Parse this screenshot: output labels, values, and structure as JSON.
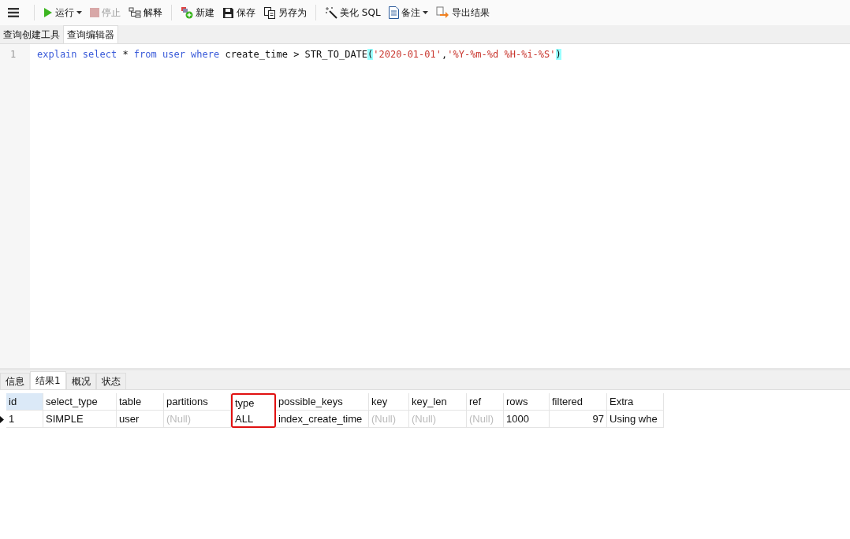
{
  "toolbar": [
    {
      "kind": "play",
      "label": "运行",
      "disabled": false,
      "dropdown": true
    },
    {
      "kind": "stop",
      "label": "停止",
      "disabled": true,
      "dropdown": false
    },
    {
      "kind": "explain",
      "label": "解释",
      "disabled": false,
      "dropdown": false
    },
    {
      "kind": "new",
      "label": "新建",
      "disabled": false,
      "dropdown": false
    },
    {
      "kind": "save",
      "label": "保存",
      "disabled": false,
      "dropdown": false
    },
    {
      "kind": "saveas",
      "label": "另存为",
      "disabled": false,
      "dropdown": false
    },
    {
      "kind": "wand",
      "label": "美化 SQL",
      "disabled": false,
      "dropdown": false
    },
    {
      "kind": "note",
      "label": "备注",
      "disabled": false,
      "dropdown": true
    },
    {
      "kind": "export",
      "label": "导出结果",
      "disabled": false,
      "dropdown": false
    }
  ],
  "editor_tabs": [
    {
      "label": "查询创建工具",
      "selected": false
    },
    {
      "label": "查询编辑器",
      "selected": true
    }
  ],
  "editor": {
    "lines": [
      {
        "number": "1",
        "tokens": [
          {
            "kind": "keyword",
            "text": "explain"
          },
          {
            "kind": "keyword",
            "text": "select"
          },
          {
            "kind": "plain",
            "text": "*"
          },
          {
            "kind": "keyword",
            "text": "from"
          },
          {
            "kind": "keyword",
            "text": "user"
          },
          {
            "kind": "keyword",
            "text": "where"
          },
          {
            "kind": "plain",
            "text": "create_time"
          },
          {
            "kind": "plain",
            "text": ">"
          },
          {
            "kind": "plain",
            "text": "STR_TO_DATE"
          },
          {
            "kind": "bracket",
            "text": "("
          },
          {
            "kind": "string",
            "text": "'2020-01-01'"
          },
          {
            "kind": "plain",
            "text": ","
          },
          {
            "kind": "string",
            "text": "'%Y-%m-%d %H-%i-%S'"
          },
          {
            "kind": "bracket",
            "text": ")"
          }
        ]
      }
    ]
  },
  "result_tabs": [
    {
      "label": "信息",
      "selected": false
    },
    {
      "label": "结果1",
      "selected": true
    },
    {
      "label": "概况",
      "selected": false
    },
    {
      "label": "状态",
      "selected": false
    }
  ],
  "table": {
    "columns": [
      {
        "label": "id",
        "selected": true,
        "highlighted": false
      },
      {
        "label": "select_type",
        "selected": false,
        "highlighted": false
      },
      {
        "label": "table",
        "selected": false,
        "highlighted": false
      },
      {
        "label": "partitions",
        "selected": false,
        "highlighted": false
      },
      {
        "label": "type",
        "selected": false,
        "highlighted": true
      },
      {
        "label": "possible_keys",
        "selected": false,
        "highlighted": false
      },
      {
        "label": "key",
        "selected": false,
        "highlighted": false
      },
      {
        "label": "key_len",
        "selected": false,
        "highlighted": false
      },
      {
        "label": "ref",
        "selected": false,
        "highlighted": false
      },
      {
        "label": "rows",
        "selected": false,
        "highlighted": false
      },
      {
        "label": "filtered",
        "selected": false,
        "highlighted": false
      },
      {
        "label": "Extra",
        "selected": false,
        "highlighted": false
      }
    ],
    "rows": [
      {
        "current": true,
        "cells": [
          {
            "text": "1",
            "null": false
          },
          {
            "text": "SIMPLE",
            "null": false
          },
          {
            "text": "user",
            "null": false
          },
          {
            "text": "(Null)",
            "null": true
          },
          {
            "text": "ALL",
            "null": false
          },
          {
            "text": "index_create_time",
            "null": false
          },
          {
            "text": "(Null)",
            "null": true
          },
          {
            "text": "(Null)",
            "null": true
          },
          {
            "text": "(Null)",
            "null": true
          },
          {
            "text": "1000",
            "null": false
          },
          {
            "text": "97",
            "null": false
          },
          {
            "text": "Using whe",
            "null": false
          }
        ]
      }
    ]
  }
}
